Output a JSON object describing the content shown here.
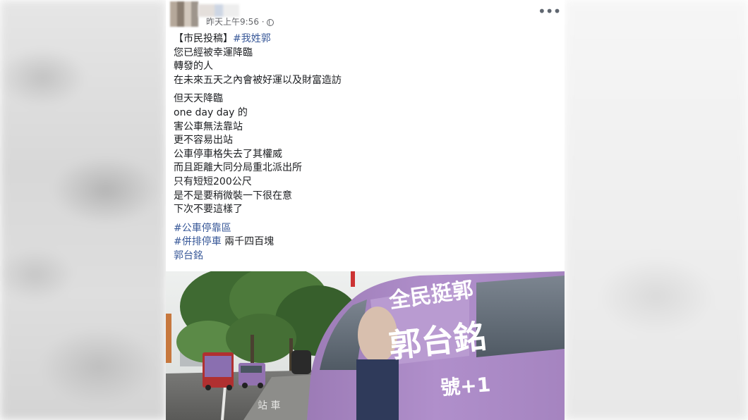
{
  "post": {
    "timestamp": "昨天上午9:56 ·",
    "body": {
      "p1": [
        {
          "text": "【市民投稿】",
          "tag": "#我姓郭"
        },
        {
          "text": "您已經被幸運降臨"
        },
        {
          "text": "轉發的人"
        },
        {
          "text": "在未來五天之內會被好運以及財富造訪"
        }
      ],
      "p2": [
        "但天天降臨",
        "one day day 的",
        "害公車無法靠站",
        "更不容易出站",
        "公車停車格失去了其權威",
        "而且距離大同分局重北派出所",
        "只有短短200公尺",
        "是不是要稍微裝一下很在意",
        "下次不要這樣了"
      ],
      "p3": {
        "tag1": "#公車停靠區",
        "tag2": "#併排停車",
        "tag2_suffix": " 兩千四百塊",
        "name_link": "郭台銘"
      }
    },
    "photo": {
      "van_text_top": "全民挺郭",
      "van_text_name": "郭台銘",
      "van_text_number": "號+1"
    },
    "icons": {
      "avatar": "avatar-image",
      "privacy": "globe-icon",
      "menu": "more-options-icon"
    },
    "colors": {
      "link": "#385898",
      "text": "#1c1e21",
      "meta": "#65676b",
      "van": "#a682c0"
    }
  }
}
